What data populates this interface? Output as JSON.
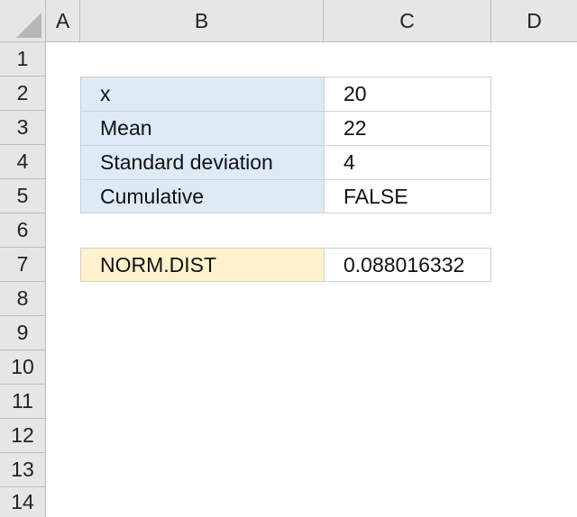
{
  "columns": [
    "A",
    "B",
    "C",
    "D"
  ],
  "rows": [
    "1",
    "2",
    "3",
    "4",
    "5",
    "6",
    "7",
    "8",
    "9",
    "10",
    "11",
    "12",
    "13",
    "14"
  ],
  "table": [
    {
      "label": "x",
      "value": "20"
    },
    {
      "label": "Mean",
      "value": "22"
    },
    {
      "label": "Standard deviation",
      "value": "4"
    },
    {
      "label": "Cumulative",
      "value": "FALSE"
    }
  ],
  "result": {
    "label": "NORM.DIST",
    "value": "0.088016332"
  },
  "colors": {
    "input_fill": "#ddebf7",
    "result_fill": "#fff2cc",
    "header_fill": "#e6e6e6"
  }
}
